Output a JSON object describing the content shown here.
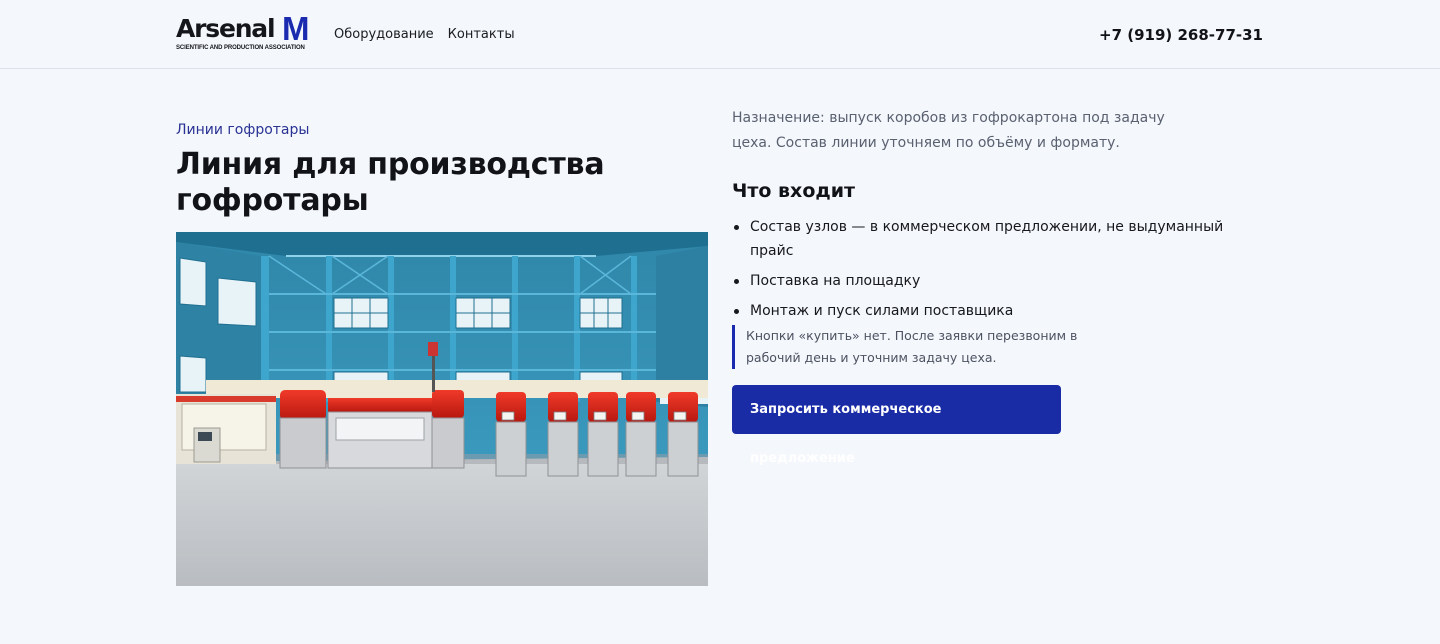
{
  "header": {
    "logo_word": "Arsenal",
    "logo_mark": "M",
    "logo_subtitle": "SCIENTIFIC AND PRODUCTION ASSOCIATION",
    "nav": [
      {
        "label": "Оборудование"
      },
      {
        "label": "Контакты"
      }
    ],
    "phone": "+7 (919) 268-77-31"
  },
  "product": {
    "category": "Линии гофротары",
    "title": "Линия для производства гофротары",
    "image_icon": "corrugated-line-photo",
    "description": "Назначение: выпуск коробов из гофрокартона под задачу цеха. Состав линии уточняем по объёму и формату.",
    "includes_title": "Что входит",
    "includes": [
      "Состав узлов — в коммерческом предложении, не выдуманный прайс",
      "Поставка на площадку",
      "Монтаж и пуск силами поставщика"
    ],
    "note": "Кнопки «купить» нет. После заявки перезвоним в рабочий день и уточним задачу цеха.",
    "cta_label": "Запросить коммерческое предложение"
  },
  "colors": {
    "accent": "#1a2ba6",
    "background": "#f4f7fc",
    "muted_text": "#5a6170",
    "category_link": "#2a3394"
  }
}
